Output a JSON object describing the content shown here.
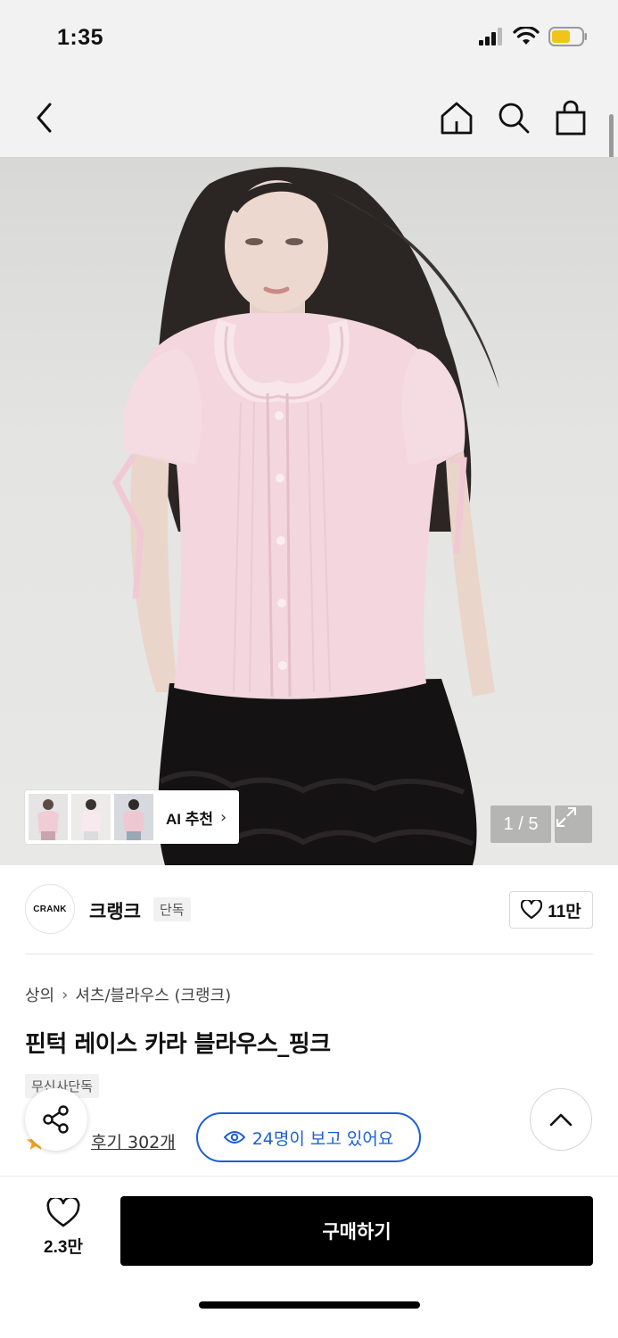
{
  "status": {
    "time": "1:35"
  },
  "nav": {
    "back_icon": "chevron-left-icon",
    "home_icon": "home-icon",
    "search_icon": "search-icon",
    "cart_icon": "shopping-bag-icon"
  },
  "gallery": {
    "ai_label": "AI 추천",
    "counter": "1 / 5"
  },
  "brand": {
    "logo_text": "CRANK",
    "name": "크랭크",
    "badge": "단독",
    "likes": "11만"
  },
  "product": {
    "breadcrumb": [
      "상의",
      "셔츠/블라우스 (크랭크)"
    ],
    "title": "핀턱 레이스 카라 블라우스_핑크",
    "tag": "무신사단독",
    "reviews": "후기 302개",
    "viewers": "24명이 보고 있어요"
  },
  "bottom": {
    "wish_count": "2.3만",
    "buy_label": "구매하기"
  },
  "colors": {
    "accent_blue": "#1b5fd6",
    "buy_bg": "#000000",
    "rating_star": "#f5a623"
  }
}
